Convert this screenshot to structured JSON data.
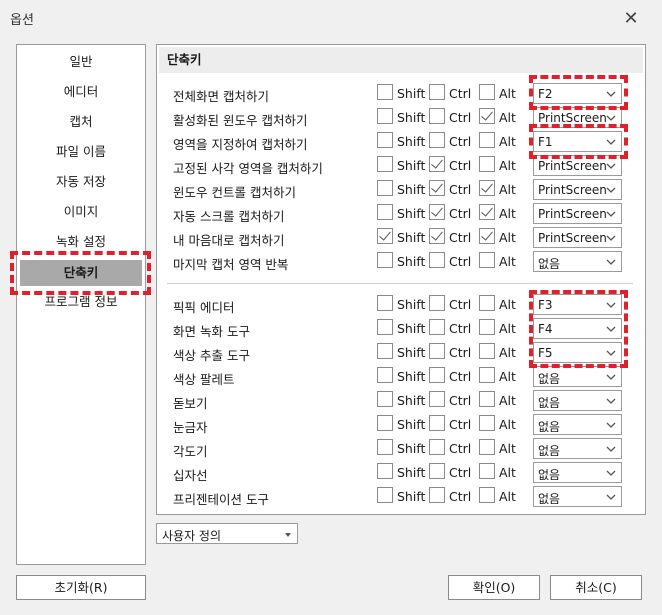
{
  "window": {
    "title": "옵션",
    "close_glyph": "✕"
  },
  "sidebar": {
    "items": [
      {
        "label": "일반"
      },
      {
        "label": "에디터"
      },
      {
        "label": "캡처"
      },
      {
        "label": "파일 이름"
      },
      {
        "label": "자동 저장"
      },
      {
        "label": "이미지"
      },
      {
        "label": "녹화 설정"
      },
      {
        "label": "단축키",
        "active": true
      },
      {
        "label": "프로그램 정보"
      }
    ]
  },
  "panel": {
    "title": "단축키",
    "modifier_labels": {
      "shift": "Shift",
      "ctrl": "Ctrl",
      "alt": "Alt"
    },
    "capture_rows": [
      {
        "label": "전체화면 캡처하기",
        "shift": false,
        "ctrl": false,
        "alt": false,
        "key": "F2"
      },
      {
        "label": "활성화된 윈도우 캡처하기",
        "shift": false,
        "ctrl": false,
        "alt": true,
        "key": "PrintScreen"
      },
      {
        "label": "영역을 지정하여 캡처하기",
        "shift": false,
        "ctrl": false,
        "alt": false,
        "key": "F1"
      },
      {
        "label": "고정된 사각 영역을 캡처하기",
        "shift": false,
        "ctrl": true,
        "alt": false,
        "key": "PrintScreen"
      },
      {
        "label": "윈도우 컨트롤 캡처하기",
        "shift": false,
        "ctrl": true,
        "alt": true,
        "key": "PrintScreen"
      },
      {
        "label": "자동 스크롤 캡처하기",
        "shift": false,
        "ctrl": true,
        "alt": true,
        "key": "PrintScreen"
      },
      {
        "label": "내 마음대로 캡처하기",
        "shift": true,
        "ctrl": true,
        "alt": true,
        "key": "PrintScreen"
      },
      {
        "label": "마지막 캡처 영역 반복",
        "shift": false,
        "ctrl": false,
        "alt": false,
        "key": "없음"
      }
    ],
    "tool_rows": [
      {
        "label": "픽픽 에디터",
        "shift": false,
        "ctrl": false,
        "alt": false,
        "key": "F3"
      },
      {
        "label": "화면 녹화 도구",
        "shift": false,
        "ctrl": false,
        "alt": false,
        "key": "F4"
      },
      {
        "label": "색상 추출 도구",
        "shift": false,
        "ctrl": false,
        "alt": false,
        "key": "F5"
      },
      {
        "label": "색상 팔레트",
        "shift": false,
        "ctrl": false,
        "alt": false,
        "key": "없음"
      },
      {
        "label": "돋보기",
        "shift": false,
        "ctrl": false,
        "alt": false,
        "key": "없음"
      },
      {
        "label": "눈금자",
        "shift": false,
        "ctrl": false,
        "alt": false,
        "key": "없음"
      },
      {
        "label": "각도기",
        "shift": false,
        "ctrl": false,
        "alt": false,
        "key": "없음"
      },
      {
        "label": "십자선",
        "shift": false,
        "ctrl": false,
        "alt": false,
        "key": "없음"
      },
      {
        "label": "프리젠테이션 도구",
        "shift": false,
        "ctrl": false,
        "alt": false,
        "key": "없음"
      }
    ]
  },
  "preset": {
    "value": "사용자 정의"
  },
  "buttons": {
    "reset": "초기화(R)",
    "ok": "확인(O)",
    "cancel": "취소(C)"
  },
  "colors": {
    "highlight": "#e0202a",
    "active_nav": "#a9a9a9"
  }
}
